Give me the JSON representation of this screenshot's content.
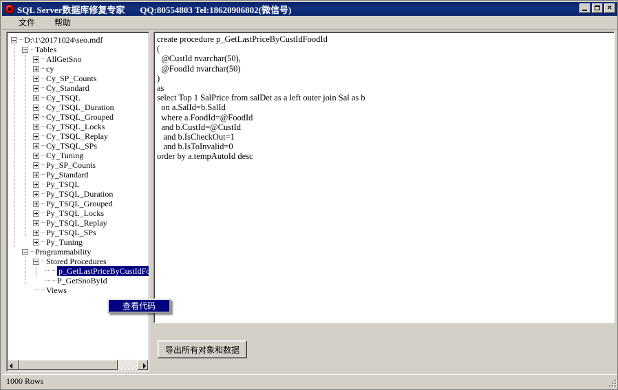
{
  "window": {
    "title": "SQL Server数据库修复专家",
    "contact": "QQ:80554803  Tel:18620906802(微信号)",
    "minimize_label": "",
    "maximize_label": "",
    "close_label": ""
  },
  "menubar": {
    "items": [
      {
        "label": "文件"
      },
      {
        "label": "帮助"
      }
    ]
  },
  "tree": {
    "root": "D:\\1\\20171024\\seo.mdf",
    "nodes": [
      {
        "label": "D:\\1\\20171024\\seo.mdf",
        "depth": 0,
        "state": "expanded",
        "selected": false
      },
      {
        "label": "Tables",
        "depth": 1,
        "state": "expanded",
        "selected": false
      },
      {
        "label": "AllGetSno",
        "depth": 2,
        "state": "collapsed",
        "selected": false
      },
      {
        "label": "cy",
        "depth": 2,
        "state": "collapsed",
        "selected": false
      },
      {
        "label": "Cy_SP_Counts",
        "depth": 2,
        "state": "collapsed",
        "selected": false
      },
      {
        "label": "Cy_Standard",
        "depth": 2,
        "state": "collapsed",
        "selected": false
      },
      {
        "label": "Cy_TSQL",
        "depth": 2,
        "state": "collapsed",
        "selected": false
      },
      {
        "label": "Cy_TSQL_Duration",
        "depth": 2,
        "state": "collapsed",
        "selected": false
      },
      {
        "label": "Cy_TSQL_Grouped",
        "depth": 2,
        "state": "collapsed",
        "selected": false
      },
      {
        "label": "Cy_TSQL_Locks",
        "depth": 2,
        "state": "collapsed",
        "selected": false
      },
      {
        "label": "Cy_TSQL_Replay",
        "depth": 2,
        "state": "collapsed",
        "selected": false
      },
      {
        "label": "Cy_TSQL_SPs",
        "depth": 2,
        "state": "collapsed",
        "selected": false
      },
      {
        "label": "Cy_Tuning",
        "depth": 2,
        "state": "collapsed",
        "selected": false
      },
      {
        "label": "Py_SP_Counts",
        "depth": 2,
        "state": "collapsed",
        "selected": false
      },
      {
        "label": "Py_Standard",
        "depth": 2,
        "state": "collapsed",
        "selected": false
      },
      {
        "label": "Py_TSQL",
        "depth": 2,
        "state": "collapsed",
        "selected": false
      },
      {
        "label": "Py_TSQL_Duration",
        "depth": 2,
        "state": "collapsed",
        "selected": false
      },
      {
        "label": "Py_TSQL_Grouped",
        "depth": 2,
        "state": "collapsed",
        "selected": false
      },
      {
        "label": "Py_TSQL_Locks",
        "depth": 2,
        "state": "collapsed",
        "selected": false
      },
      {
        "label": "Py_TSQL_Replay",
        "depth": 2,
        "state": "collapsed",
        "selected": false
      },
      {
        "label": "Py_TSQL_SPs",
        "depth": 2,
        "state": "collapsed",
        "selected": false
      },
      {
        "label": "Py_Tuning",
        "depth": 2,
        "state": "collapsed",
        "selected": false
      },
      {
        "label": "Programmability",
        "depth": 1,
        "state": "expanded",
        "selected": false
      },
      {
        "label": "Stored Procedures",
        "depth": 2,
        "state": "expanded",
        "selected": false
      },
      {
        "label": "p_GetLastPriceByCustIdFoodId",
        "depth": 3,
        "state": "leaf",
        "selected": true
      },
      {
        "label": "P_GetSnoById",
        "depth": 3,
        "state": "leaf",
        "selected": false
      },
      {
        "label": "Views",
        "depth": 2,
        "state": "leaf",
        "selected": false
      }
    ]
  },
  "context_menu": {
    "items": [
      {
        "label": "查看代码",
        "highlighted": true
      }
    ]
  },
  "code": {
    "text": "create procedure p_GetLastPriceByCustIdFoodId\n(\n  @CustId nvarchar(50),\n  @FoodId nvarchar(50)\n)\nas\nselect Top 1 SalPrice from salDet as a left outer join Sal as b\n  on a.SalId=b.SalId\n  where a.FoodId=@FoodId\n  and b.CustId=@CustId\n   and b.IsCheckOut=1\n   and b.IsToInvalid=0\norder by a.tempAutoId desc"
  },
  "actions": {
    "export_label": "导出所有对象和数据"
  },
  "statusbar": {
    "text": "1000 Rows"
  },
  "scrollbar": {
    "left_arrow": "◀",
    "right_arrow": "▶"
  },
  "colors": {
    "titlebar": "#0a246a",
    "face": "#d4d0c8",
    "selection": "#000080",
    "panel": "#ffffff"
  }
}
